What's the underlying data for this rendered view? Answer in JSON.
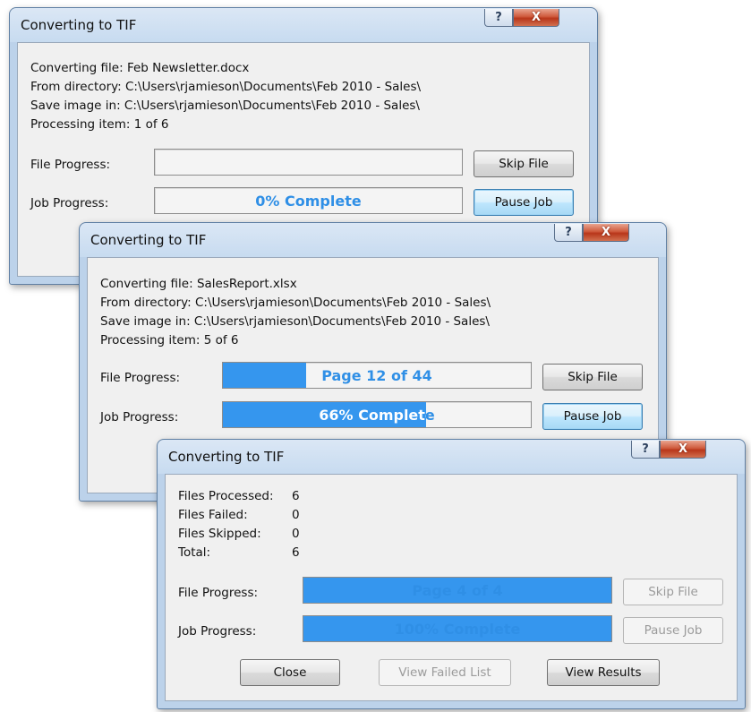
{
  "windows": [
    {
      "title": "Converting to TIF",
      "help": "?",
      "close": "X",
      "info": [
        "Converting file: Feb Newsletter.docx",
        "From directory: C:\\Users\\rjamieson\\Documents\\Feb 2010 - Sales\\",
        "Save image in: C:\\Users\\rjamieson\\Documents\\Feb 2010 - Sales\\",
        "Processing item: 1 of 6"
      ],
      "file_progress_label": "File Progress:",
      "file_progress_text": "",
      "file_progress_fraction": 0,
      "job_progress_label": "Job Progress:",
      "job_progress_text": "0% Complete",
      "job_progress_fraction": 0,
      "skip_label": "Skip File",
      "pause_label": "Pause Job"
    },
    {
      "title": "Converting to TIF",
      "help": "?",
      "close": "X",
      "info": [
        "Converting file: SalesReport.xlsx",
        "From directory: C:\\Users\\rjamieson\\Documents\\Feb 2010 - Sales\\",
        "Save image in: C:\\Users\\rjamieson\\Documents\\Feb 2010 - Sales\\",
        "Processing item: 5 of 6"
      ],
      "file_progress_label": "File Progress:",
      "file_progress_text": "Page 12 of 44",
      "file_progress_fraction": 0.27,
      "job_progress_label": "Job Progress:",
      "job_progress_text": "66% Complete",
      "job_progress_fraction": 0.66,
      "skip_label": "Skip File",
      "pause_label": "Pause Job"
    },
    {
      "title": "Converting to TIF",
      "help": "?",
      "close": "X",
      "summary": [
        {
          "label": "Files Processed:",
          "value": "6"
        },
        {
          "label": "Files Failed:",
          "value": "0"
        },
        {
          "label": "Files Skipped:",
          "value": "0"
        },
        {
          "label": "Total:",
          "value": "6"
        }
      ],
      "file_progress_label": "File Progress:",
      "file_progress_text": "Page 4 of 4",
      "file_progress_fraction": 1,
      "job_progress_label": "Job Progress:",
      "job_progress_text": "100% Complete",
      "job_progress_fraction": 1,
      "skip_label": "Skip File",
      "pause_label": "Pause Job",
      "close_label": "Close",
      "view_failed_label": "View Failed List",
      "view_results_label": "View Results"
    }
  ],
  "colors": {
    "progress_fill": "#3596ee",
    "progress_text": "#2f8fe6"
  }
}
